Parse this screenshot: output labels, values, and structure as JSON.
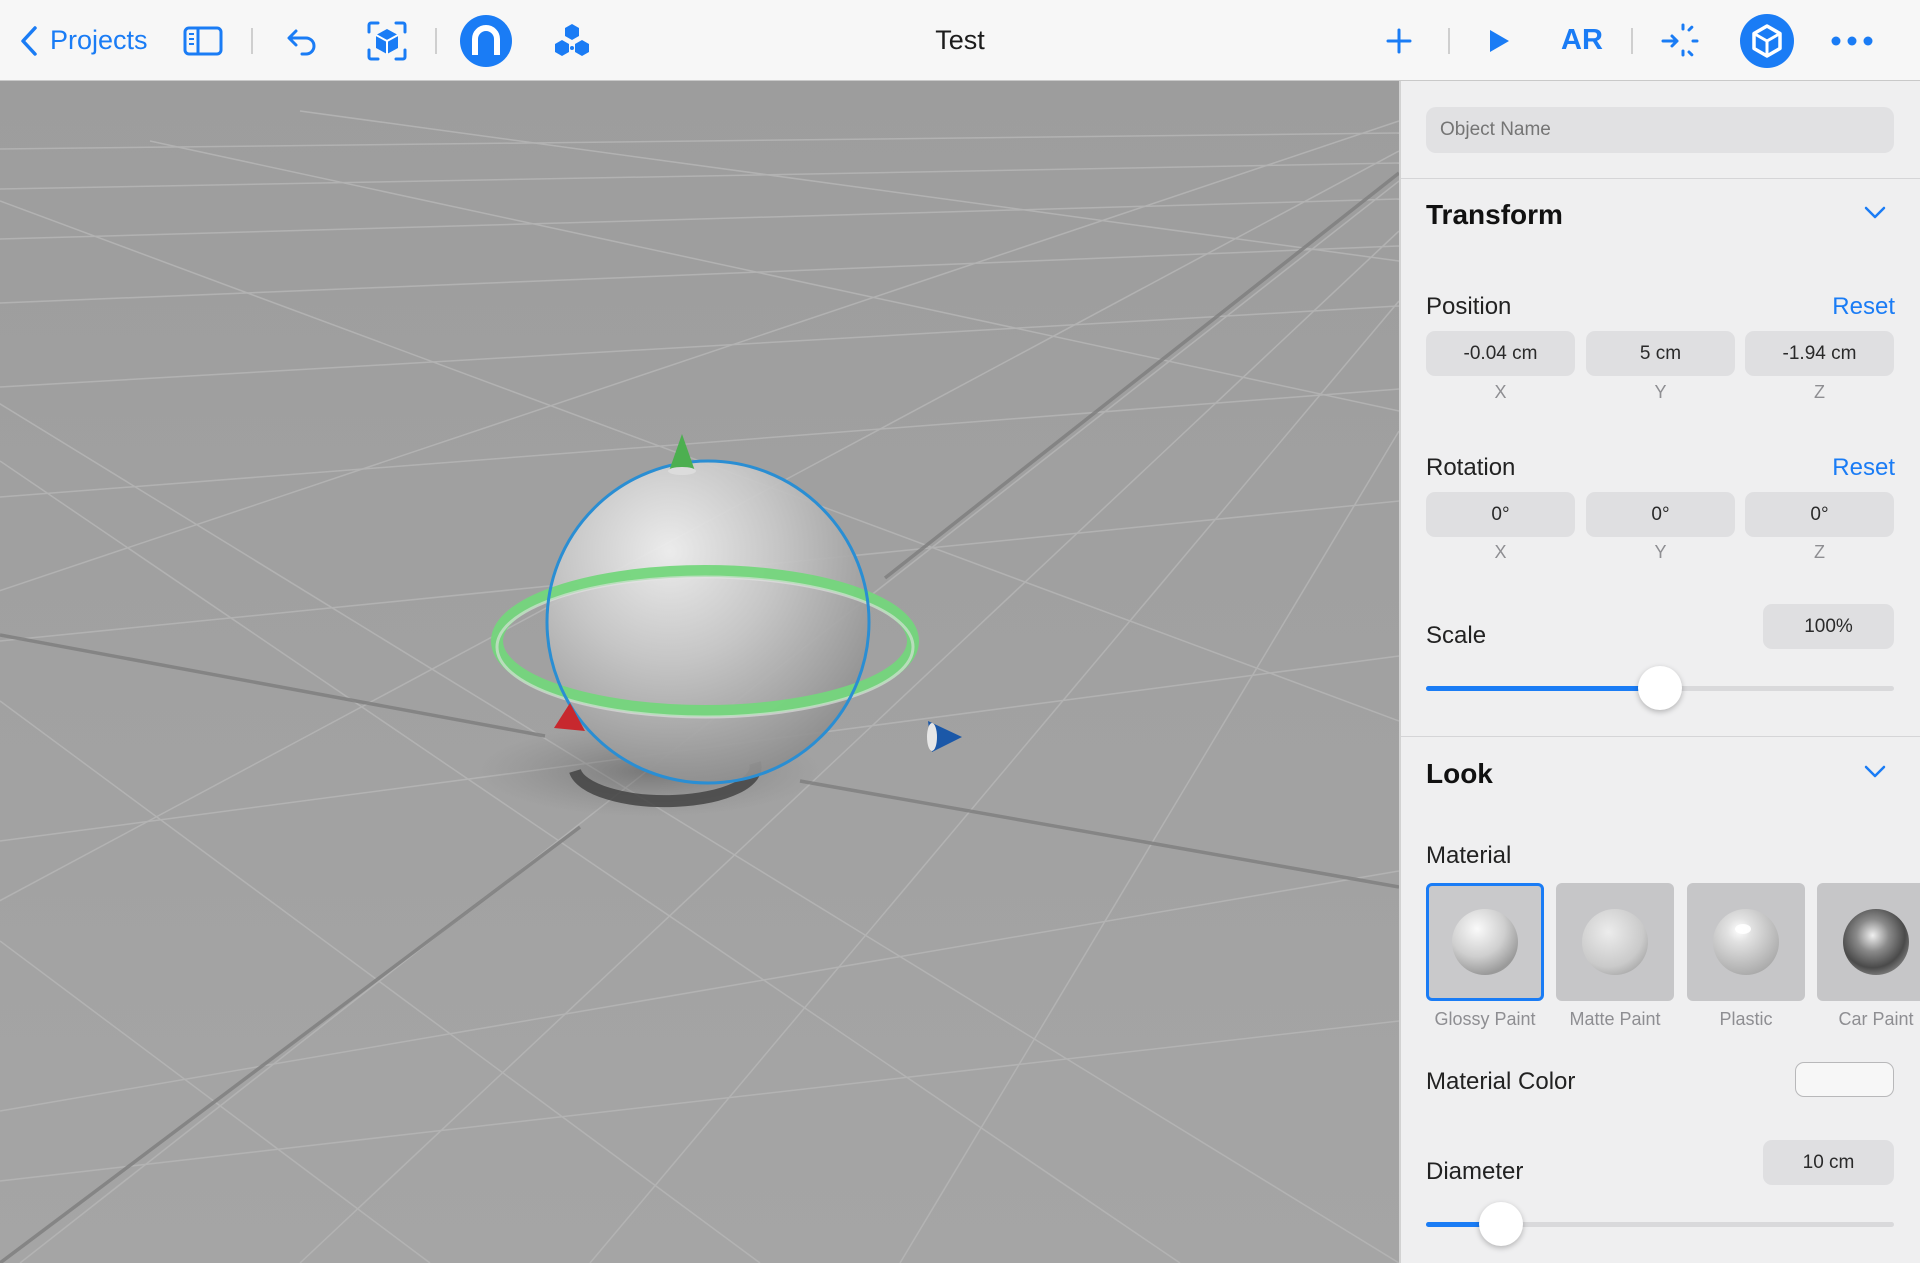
{
  "toolbar": {
    "back_label": "Projects",
    "title": "Test",
    "ar_label": "AR",
    "accent": "#1a7cf5"
  },
  "inspector": {
    "object_name_placeholder": "Object Name",
    "transform": {
      "title": "Transform",
      "position": {
        "label": "Position",
        "reset": "Reset",
        "x": "-0.04 cm",
        "y": "5 cm",
        "z": "-1.94 cm",
        "axes": [
          "X",
          "Y",
          "Z"
        ]
      },
      "rotation": {
        "label": "Rotation",
        "reset": "Reset",
        "x": "0°",
        "y": "0°",
        "z": "0°",
        "axes": [
          "X",
          "Y",
          "Z"
        ]
      },
      "scale": {
        "label": "Scale",
        "value": "100%",
        "slider_fraction": 0.5
      }
    },
    "look": {
      "title": "Look",
      "material_label": "Material",
      "materials": [
        {
          "label": "Glossy Paint",
          "selected": true
        },
        {
          "label": "Matte Paint",
          "selected": false
        },
        {
          "label": "Plastic",
          "selected": false
        },
        {
          "label": "Car Paint",
          "selected": false
        }
      ],
      "material_color_label": "Material Color",
      "diameter": {
        "label": "Diameter",
        "value": "10 cm",
        "slider_fraction": 0.16
      }
    }
  }
}
